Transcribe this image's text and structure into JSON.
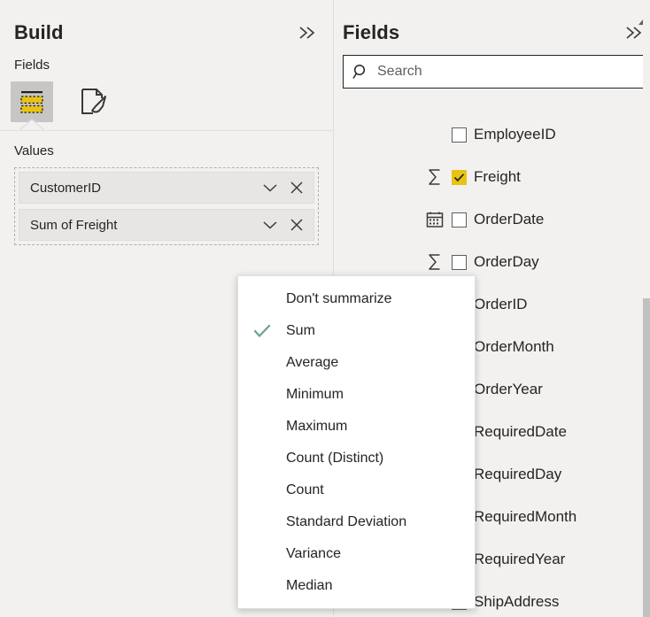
{
  "build_pane": {
    "title": "Build",
    "collapse_icon": "double-chevron-right-icon",
    "fields_section_label": "Fields",
    "viz_icons": [
      {
        "name": "fields-pane-icon",
        "selected": true
      },
      {
        "name": "format-pane-icon",
        "selected": false
      }
    ],
    "values_label": "Values",
    "value_wells": [
      {
        "label": "CustomerID",
        "dropdown_icon": "chevron-down-icon",
        "remove_icon": "close-icon"
      },
      {
        "label": "Sum of Freight",
        "dropdown_icon": "chevron-down-icon",
        "remove_icon": "close-icon"
      }
    ]
  },
  "fields_pane": {
    "title": "Fields",
    "collapse_icon": "double-chevron-right-icon",
    "search": {
      "placeholder": "Search",
      "value": "",
      "icon": "search-icon"
    },
    "scroll_up_icon": "triangle-up-icon",
    "items": [
      {
        "label": "EmployeeID",
        "type_icon": "",
        "checked": false
      },
      {
        "label": "Freight",
        "type_icon": "sigma-icon",
        "checked": true
      },
      {
        "label": "OrderDate",
        "type_icon": "calendar-icon",
        "checked": false
      },
      {
        "label": "OrderDay",
        "type_icon": "sigma-icon",
        "checked": false
      },
      {
        "label": "OrderID",
        "type_icon": "sigma-icon",
        "checked": false
      },
      {
        "label": "OrderMonth",
        "type_icon": "sigma-icon",
        "checked": false
      },
      {
        "label": "OrderYear",
        "type_icon": "sigma-icon",
        "checked": false
      },
      {
        "label": "RequiredDate",
        "type_icon": "calendar-icon",
        "checked": false
      },
      {
        "label": "RequiredDay",
        "type_icon": "sigma-icon",
        "checked": false
      },
      {
        "label": "RequiredMonth",
        "type_icon": "sigma-icon",
        "checked": false
      },
      {
        "label": "RequiredYear",
        "type_icon": "sigma-icon",
        "checked": false
      },
      {
        "label": "ShipAddress",
        "type_icon": "",
        "checked": false
      }
    ]
  },
  "aggregation_menu": {
    "selected": "Sum",
    "check_icon": "checkmark-icon",
    "items": [
      {
        "label": "Don't summarize",
        "checked": false
      },
      {
        "label": "Sum",
        "checked": true
      },
      {
        "label": "Average",
        "checked": false
      },
      {
        "label": "Minimum",
        "checked": false
      },
      {
        "label": "Maximum",
        "checked": false
      },
      {
        "label": "Count (Distinct)",
        "checked": false
      },
      {
        "label": "Count",
        "checked": false
      },
      {
        "label": "Standard Deviation",
        "checked": false
      },
      {
        "label": "Variance",
        "checked": false
      },
      {
        "label": "Median",
        "checked": false
      }
    ]
  },
  "colors": {
    "pane_background": "#f2f1f0",
    "accent_yellow": "#e8c313",
    "check_green": "#6aa68a",
    "text": "#252423",
    "scrollbar_thumb": "#c1c1c1"
  }
}
